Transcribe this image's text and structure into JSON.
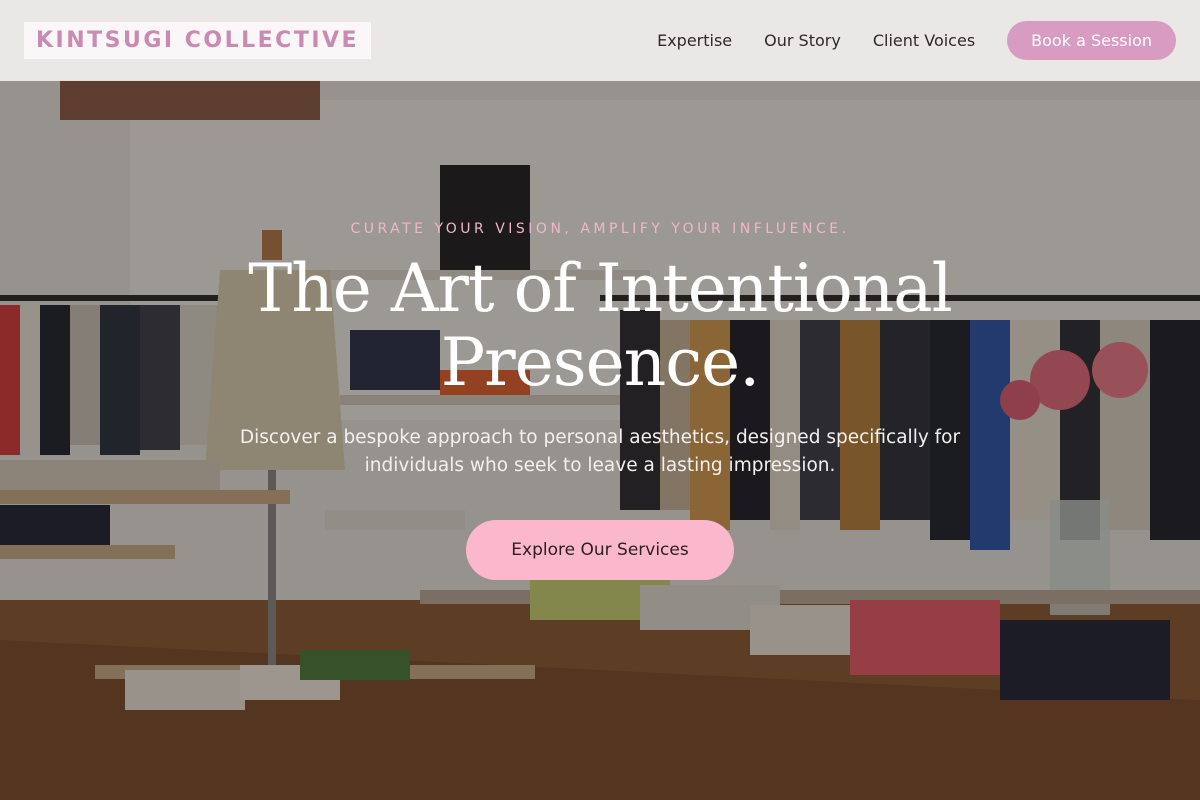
{
  "header": {
    "logo": "KINTSUGI COLLECTIVE",
    "nav": [
      "Expertise",
      "Our Story",
      "Client Voices"
    ],
    "cta_label": "Book a Session"
  },
  "hero": {
    "tagline": "CURATE YOUR VISION, AMPLIFY YOUR INFLUENCE.",
    "headline": "The Art of Intentional Presence.",
    "subtext": "Discover a bespoke approach to personal aesthetics, designed specifically for individuals who seek to leave a lasting impression.",
    "cta_label": "Explore Our Services",
    "background_description_icon": "boutique-photo"
  },
  "colors": {
    "brand_pink": "#d89bc2",
    "cta_pink": "#fbb8cd",
    "tagline_pink": "#f1b6cc",
    "logo_pink": "#c98ab4",
    "text_dark": "#2e2a2a"
  }
}
